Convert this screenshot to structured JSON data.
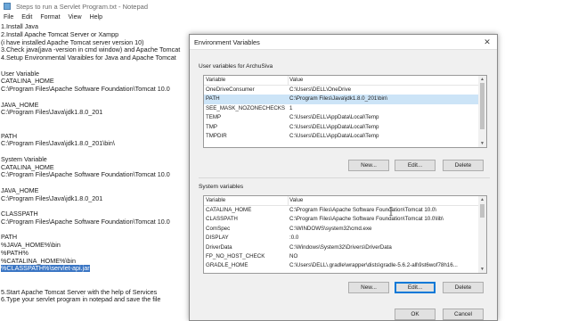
{
  "notepad": {
    "title": "Steps to run a Servlet Program.txt - Notepad",
    "menu": [
      "File",
      "Edit",
      "Format",
      "View",
      "Help"
    ],
    "lines": [
      "1.Install Java",
      "2.Install Apache Tomcat Server or Xampp",
      "(i have installed Apache Tomcat server version 10)",
      "3.Check java(java -version in cmd window) and Apache Tomcat",
      "4.Setup Environmental Varaibles for Java and Apache Tomcat",
      "",
      "User Variable",
      "CATALINA_HOME",
      "C:\\Program Files\\Apache Software Foundation\\Tomcat 10.0",
      "",
      "JAVA_HOME",
      "C:\\Program Files\\Java\\jdk1.8.0_201",
      "",
      "",
      "PATH",
      "C:\\Program Files\\Java\\jdk1.8.0_201\\bin\\",
      "",
      "System Variable",
      "CATALINA_HOME",
      "C:\\Program Files\\Apache Software Foundation\\Tomcat 10.0",
      "",
      "JAVA_HOME",
      "C:\\Program Files\\Java\\jdk1.8.0_201",
      "",
      "CLASSPATH",
      "C:\\Program Files\\Apache Software Foundation\\Tomcat 10.0",
      "",
      "PATH",
      "%JAVA_HOME%\\bin",
      "%PATH%",
      "%CATALINA_HOME%\\bin",
      "%CLASSPATH%\\servlet-api.jar",
      "",
      "",
      "5.Start Apache Tomcat Server with the help of Services",
      "6.Type your servlet program in notepad and save the file"
    ],
    "selected_line_index": 31
  },
  "dialog": {
    "title": "Environment Variables",
    "close_glyph": "✕",
    "user_section_label": "User variables for ArchuSiva",
    "system_section_label": "System variables",
    "col_variable": "Variable",
    "col_value": "Value",
    "user_vars": [
      {
        "name": "OneDriveConsumer",
        "value": "C:\\Users\\DELL\\OneDrive"
      },
      {
        "name": "PATH",
        "value": "C:\\Program Files\\Java\\jdk1.8.0_201\\bin\\"
      },
      {
        "name": "SEE_MASK_NOZONECHECKS",
        "value": "1"
      },
      {
        "name": "TEMP",
        "value": "C:\\Users\\DELL\\AppData\\Local\\Temp"
      },
      {
        "name": "TMP",
        "value": "C:\\Users\\DELL\\AppData\\Local\\Temp"
      },
      {
        "name": "TMPDIR",
        "value": "C:\\Users\\DELL\\AppData\\Local\\Temp"
      }
    ],
    "user_selected_index": 1,
    "system_vars": [
      {
        "name": "CATALINA_HOME",
        "value": "C:\\Program Files\\Apache Software Foundation\\Tomcat 10.0\\"
      },
      {
        "name": "CLASSPATH",
        "value": "C:\\Program Files\\Apache Software Foundation\\Tomcat 10.0\\lib\\"
      },
      {
        "name": "ComSpec",
        "value": "C:\\WINDOWS\\system32\\cmd.exe"
      },
      {
        "name": "DISPLAY",
        "value": ":0.0"
      },
      {
        "name": "DriverData",
        "value": "C:\\Windows\\System32\\Drivers\\DriverData"
      },
      {
        "name": "FP_NO_HOST_CHECK",
        "value": "NO"
      },
      {
        "name": "GRADLE_HOME",
        "value": "C:\\Users\\DELL\\.gradle\\wrapper\\dists\\gradle-5.6.2-all\\9st6wof78h16..."
      }
    ],
    "buttons": {
      "user_new": "New...",
      "user_edit": "Edit...",
      "user_delete": "Delete",
      "system_new": "New...",
      "system_edit": "Edit...",
      "system_delete": "Delete",
      "ok": "OK",
      "cancel": "Cancel"
    },
    "scroll_arrows": {
      "up": "▲",
      "down": "▼"
    }
  },
  "colors": {
    "selection": "#3b76c4",
    "list_selection": "#cce4f7",
    "focus_border": "#0078d7"
  }
}
